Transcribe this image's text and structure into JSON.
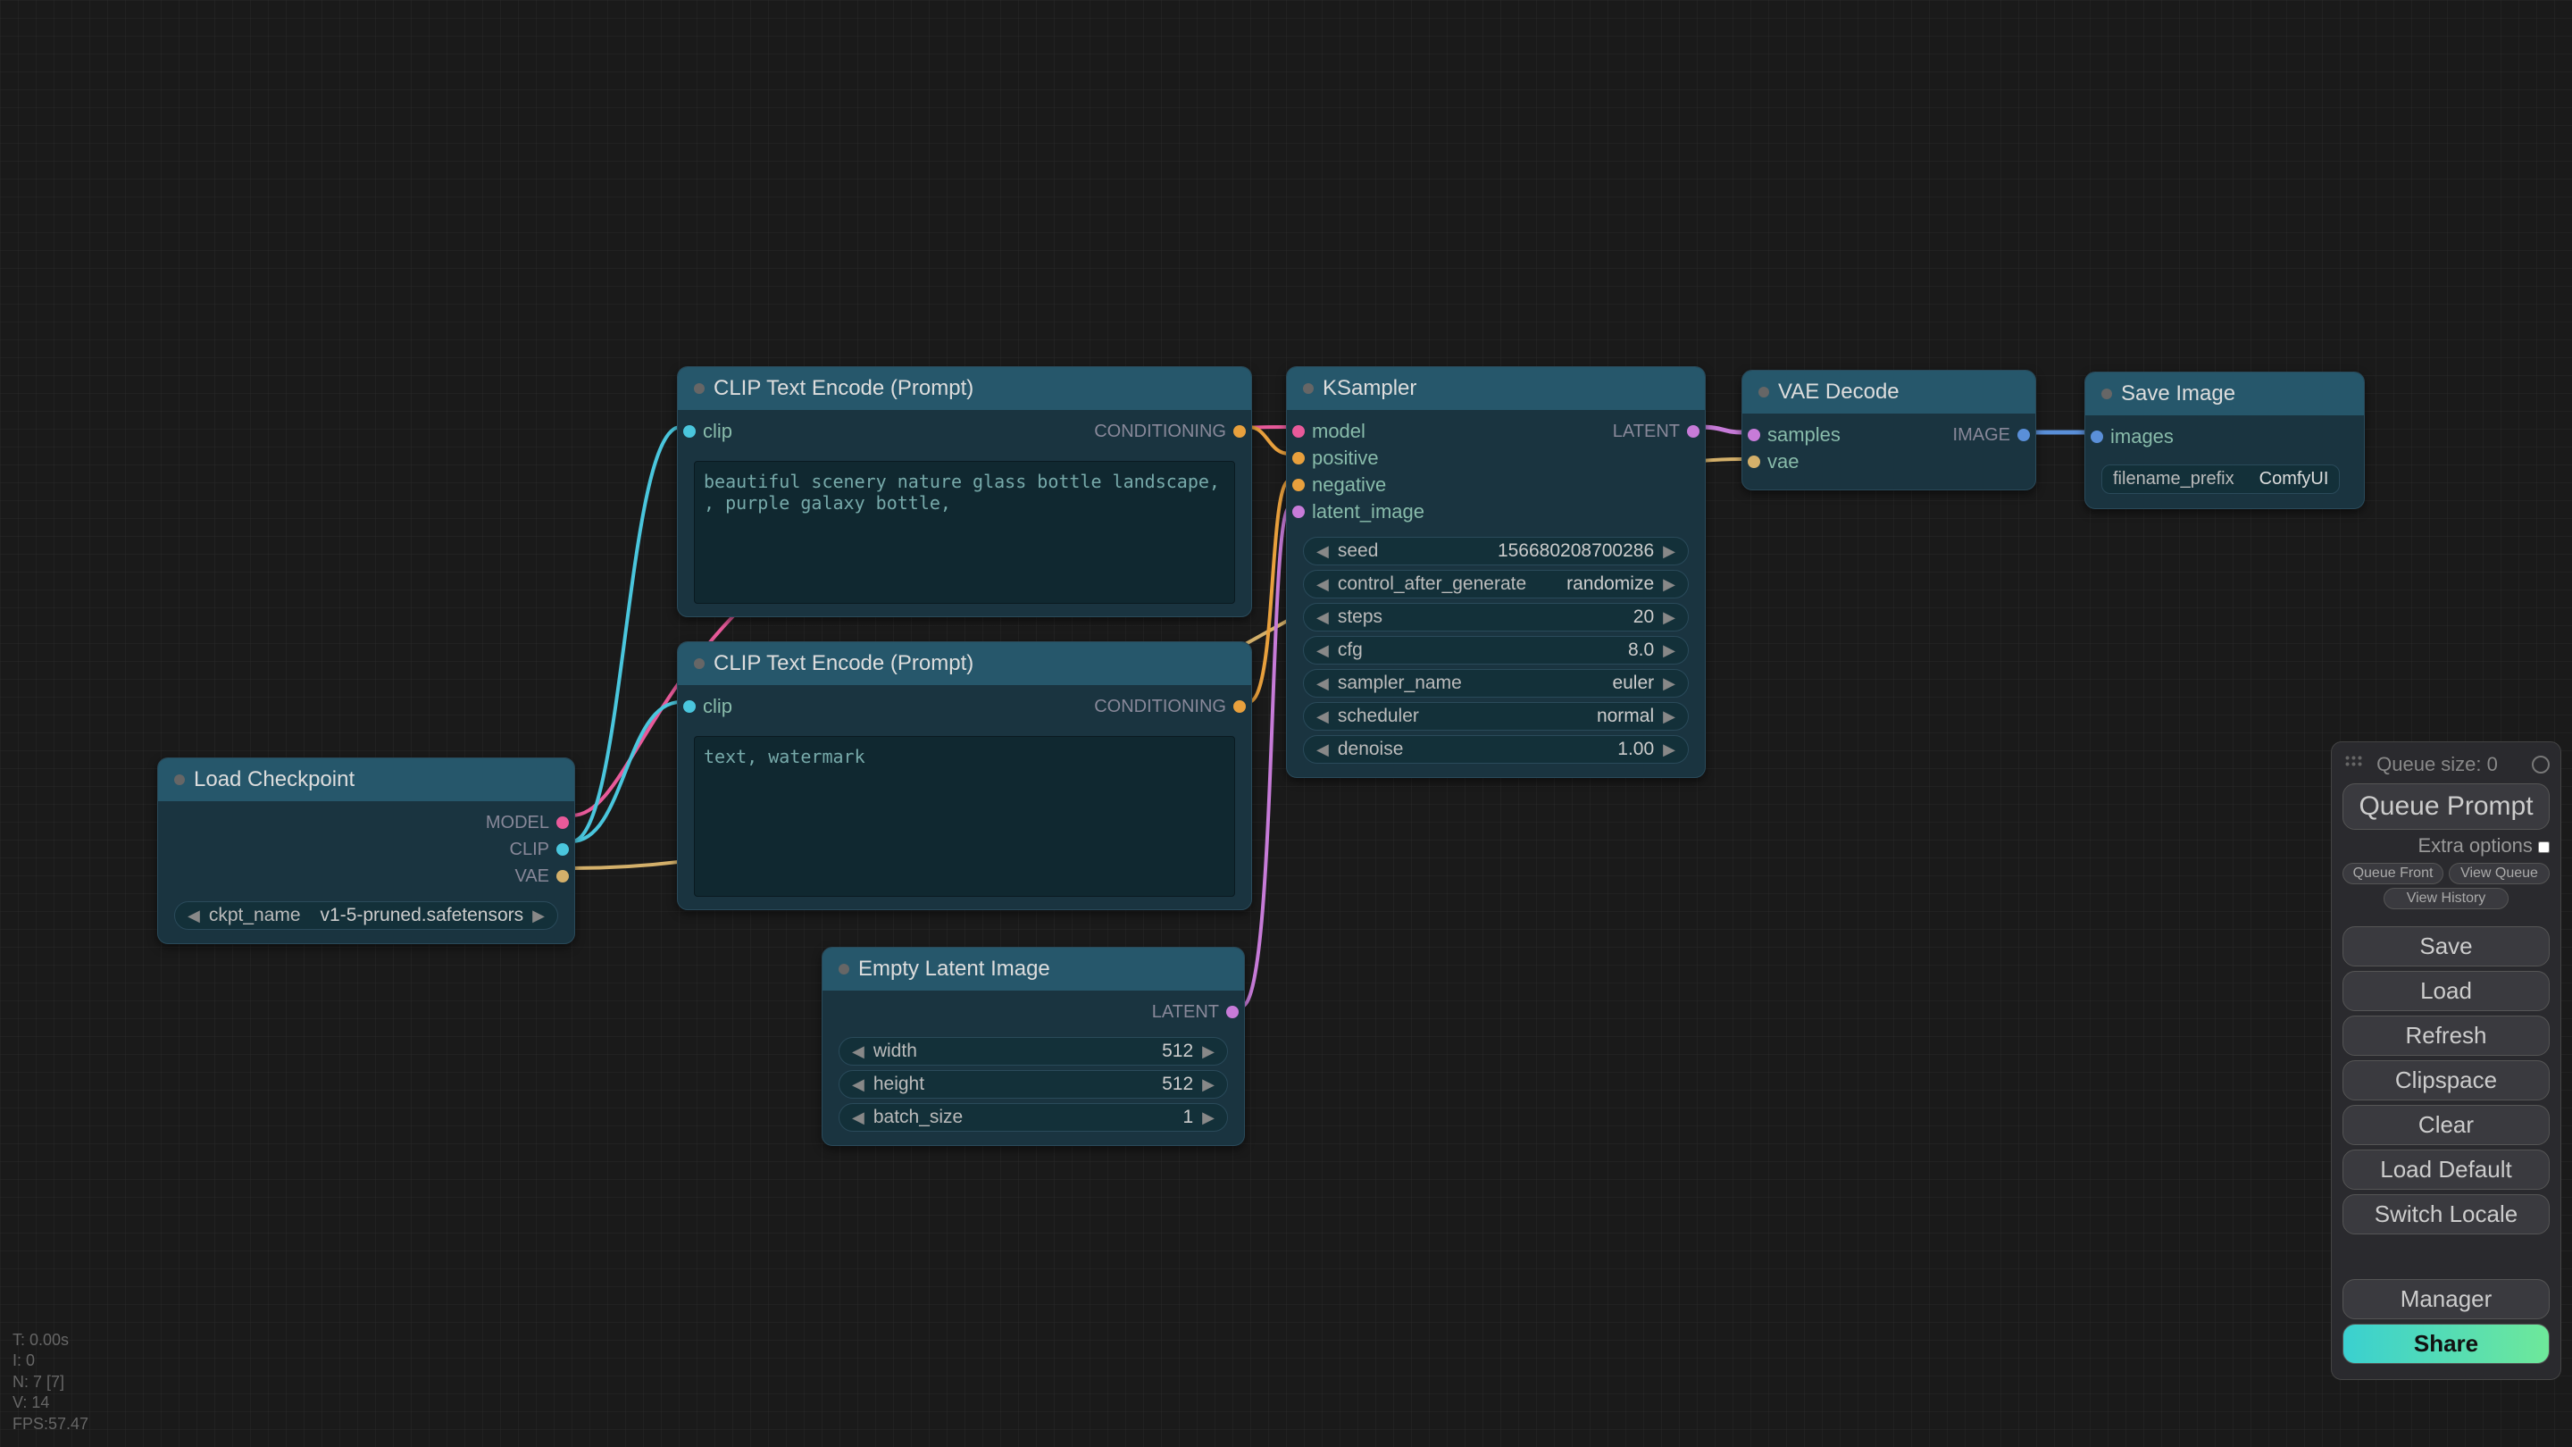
{
  "panel": {
    "queue_size_label": "Queue size: 0",
    "queue_prompt": "Queue Prompt",
    "extra_options": "Extra options",
    "queue_front": "Queue Front",
    "view_queue": "View Queue",
    "view_history": "View History",
    "save": "Save",
    "load": "Load",
    "refresh": "Refresh",
    "clipspace": "Clipspace",
    "clear": "Clear",
    "load_default": "Load Default",
    "switch_locale": "Switch Locale",
    "manager": "Manager",
    "share": "Share"
  },
  "stats": {
    "t": "T: 0.00s",
    "i": "I: 0",
    "n": "N: 7 [7]",
    "v": "V: 14",
    "fps": "FPS:57.47"
  },
  "nodes": {
    "load_ckpt": {
      "title": "Load Checkpoint",
      "out_model": "MODEL",
      "out_clip": "CLIP",
      "out_vae": "VAE",
      "ckpt_label": "ckpt_name",
      "ckpt_value": "v1-5-pruned.safetensors"
    },
    "clip_pos": {
      "title": "CLIP Text Encode (Prompt)",
      "in_clip": "clip",
      "out": "CONDITIONING",
      "text": "beautiful scenery nature glass bottle landscape, , purple galaxy bottle,"
    },
    "clip_neg": {
      "title": "CLIP Text Encode (Prompt)",
      "in_clip": "clip",
      "out": "CONDITIONING",
      "text": "text, watermark"
    },
    "empty": {
      "title": "Empty Latent Image",
      "out": "LATENT",
      "width_l": "width",
      "width_v": "512",
      "height_l": "height",
      "height_v": "512",
      "batch_l": "batch_size",
      "batch_v": "1"
    },
    "ksampler": {
      "title": "KSampler",
      "in_model": "model",
      "in_positive": "positive",
      "in_negative": "negative",
      "in_latent": "latent_image",
      "out": "LATENT",
      "seed_l": "seed",
      "seed_v": "156680208700286",
      "cag_l": "control_after_generate",
      "cag_v": "randomize",
      "steps_l": "steps",
      "steps_v": "20",
      "cfg_l": "cfg",
      "cfg_v": "8.0",
      "sampler_l": "sampler_name",
      "sampler_v": "euler",
      "sched_l": "scheduler",
      "sched_v": "normal",
      "denoise_l": "denoise",
      "denoise_v": "1.00"
    },
    "vae": {
      "title": "VAE Decode",
      "in_samples": "samples",
      "in_vae": "vae",
      "out": "IMAGE"
    },
    "save": {
      "title": "Save Image",
      "in_images": "images",
      "prefix_l": "filename_prefix",
      "prefix_v": "ComfyUI"
    }
  }
}
